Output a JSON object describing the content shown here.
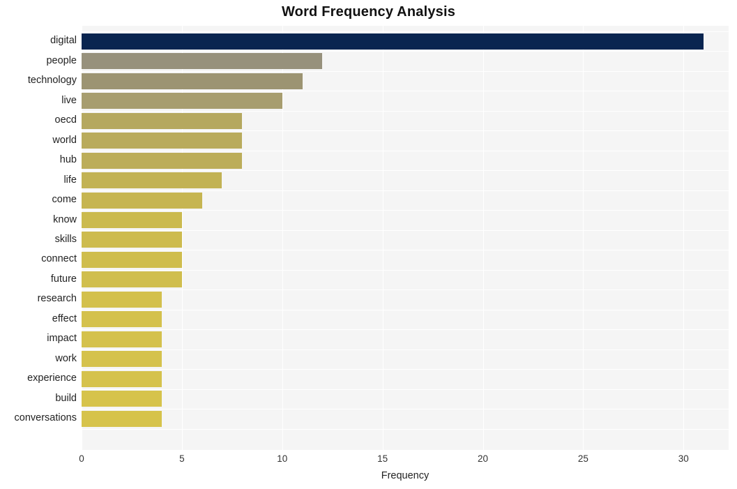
{
  "chart_data": {
    "type": "bar",
    "orientation": "horizontal",
    "title": "Word Frequency Analysis",
    "xlabel": "Frequency",
    "ylabel": "",
    "categories": [
      "digital",
      "people",
      "technology",
      "live",
      "oecd",
      "world",
      "hub",
      "life",
      "come",
      "know",
      "skills",
      "connect",
      "future",
      "research",
      "effect",
      "impact",
      "work",
      "experience",
      "build",
      "conversations"
    ],
    "values": [
      31,
      12,
      11,
      10,
      8,
      8,
      8,
      7,
      6,
      5,
      5,
      5,
      5,
      4,
      4,
      4,
      4,
      4,
      4,
      4
    ],
    "bar_colors": [
      "#0a2550",
      "#97917c",
      "#9c9472",
      "#a79d6f",
      "#b5a85f",
      "#b9ab5c",
      "#bcad59",
      "#c2b254",
      "#c6b551",
      "#cbba4e",
      "#cdbb4e",
      "#cfbd4d",
      "#d0be4d",
      "#d3c04c",
      "#d4c14c",
      "#d4c14c",
      "#d5c24c",
      "#d5c24c",
      "#d6c34b",
      "#d6c34b"
    ],
    "xlim": [
      0,
      32.25
    ],
    "xticks": [
      0,
      5,
      10,
      15,
      20,
      25,
      30
    ],
    "xtick_labels": [
      "0",
      "5",
      "10",
      "15",
      "20",
      "25",
      "30"
    ],
    "grid": true,
    "grid_color": "#ffffff",
    "plot_background": "#f5f5f5",
    "figure_background": "#ffffff",
    "legend": null
  }
}
